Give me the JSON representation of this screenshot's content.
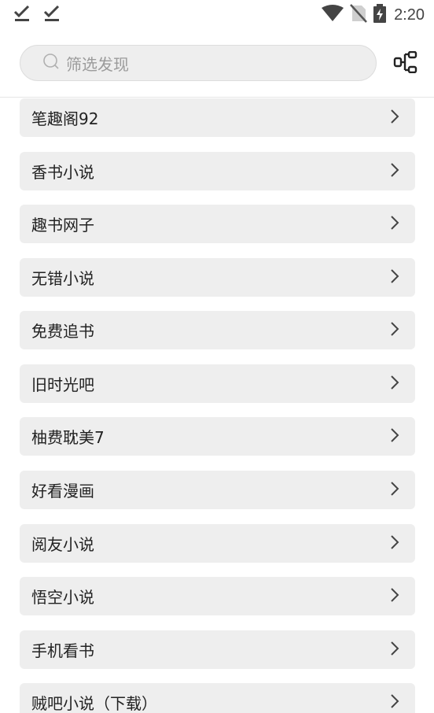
{
  "status_bar": {
    "time": "2:20",
    "icons": [
      "download-done-icon",
      "download-done-icon",
      "wifi-icon",
      "no-sim-icon",
      "battery-charging-icon"
    ]
  },
  "search": {
    "placeholder": "筛选发现"
  },
  "toolbar": {
    "group_icon": "group-tree-icon"
  },
  "sources": [
    {
      "label": "笔趣阁92"
    },
    {
      "label": "香书小说"
    },
    {
      "label": "趣书网子"
    },
    {
      "label": "无错小说"
    },
    {
      "label": "免费追书"
    },
    {
      "label": "旧时光吧"
    },
    {
      "label": "柚费耽美7"
    },
    {
      "label": "好看漫画"
    },
    {
      "label": "阅友小说"
    },
    {
      "label": "悟空小说"
    },
    {
      "label": "手机看书"
    },
    {
      "label": "贼吧小说（下载）"
    }
  ],
  "colors": {
    "item_bg": "#eeeeee",
    "text": "#222222",
    "placeholder": "#9b9b9b"
  }
}
